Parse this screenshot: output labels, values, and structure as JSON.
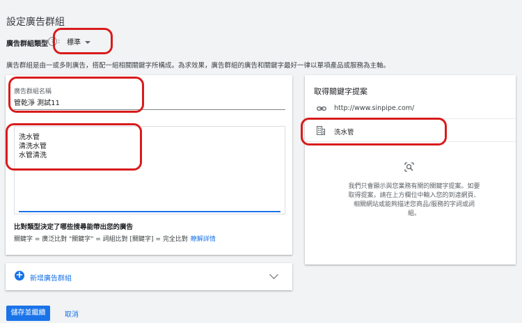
{
  "page": {
    "title": "設定廣告群組",
    "type_label": "廣告群組類型",
    "help_glyph": "?",
    "colon": ":",
    "type_value": "標準",
    "description": "廣告群組是由一或多則廣告，搭配一組相關關鍵字所構成。為求效果，廣告群組的廣告和關鍵字最好一律以單項產品或服務為主軸。"
  },
  "ad_group": {
    "name_label": "廣告群組名稱",
    "name_value": "管乾淨 測試11",
    "keywords": [
      "洗水管",
      "清洗水管",
      "水管清洗"
    ],
    "match_title": "比對類型決定了哪些搜尋能帶出您的廣告",
    "match_desc": "關鍵字 = 廣泛比對 \"關鍵字\" = 詞組比對 [關鍵字] = 完全比對",
    "match_link": "瞭解詳情"
  },
  "add_group": {
    "icon": "+",
    "label": "新增廣告群組"
  },
  "keyword_planner": {
    "title": "取得關鍵字提案",
    "url": "http://www.sinpipe.com/",
    "keyword": "洗水管",
    "help_text": "我們只會顯示與您業務有關的關鍵字提案。如要取得提案，請在上方欄位中輸入您的到達網頁、相關網站或能夠描述您商品/服務的字詞或詞組。"
  },
  "actions": {
    "save_label": "儲存並繼續",
    "cancel_label": "取消"
  },
  "colors": {
    "accent": "#1a73e8",
    "annotation": "#d81b1b"
  }
}
